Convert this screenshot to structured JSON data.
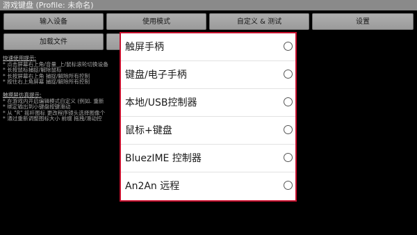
{
  "window": {
    "title": "游戏键盘 (Profile: 未命名)"
  },
  "toolbar": {
    "input_device": "输入设备",
    "usage_mode": "使用模式",
    "custom_test": "自定义 & 测试",
    "settings": "设置",
    "load_file": "加载文件"
  },
  "tips": {
    "quick_heading": "快速使用提示:",
    "quick_lines": [
      "* 点击屏幕右上角/音量_上/鼠标滚轮切换设备",
      "* 长按鼠标捕捉/解除鼠标",
      "* 长按屏幕右上角 捕捉/解除所有控制",
      "* 按住右上角屏幕 捕捉/解除所有控制"
    ],
    "touch_heading": "触摸屏仿真提示:",
    "touch_lines": [
      "* 在游戏内开启编辑模式自定义 (例如. 重新",
      "* 绑定输出到小键盘按键滑动",
      "* 从 \"R\" 摇杆图标 更改程序镜头选择图像个",
      "* 通过重新调整图标大小 前缀 拖拽/滑动控"
    ]
  },
  "dialog": {
    "options": [
      {
        "label": "触屏手柄",
        "selected": false
      },
      {
        "label": "键盘/电子手柄",
        "selected": false
      },
      {
        "label": "本地/USB控制器",
        "selected": false
      },
      {
        "label": "鼠标+键盘",
        "selected": false
      },
      {
        "label": "BluezIME 控制器",
        "selected": false
      },
      {
        "label": "An2An 远程",
        "selected": false
      }
    ]
  },
  "colors": {
    "dialog_border": "#c8102e",
    "titlebar": "#8a8a8a",
    "background": "#000000"
  }
}
